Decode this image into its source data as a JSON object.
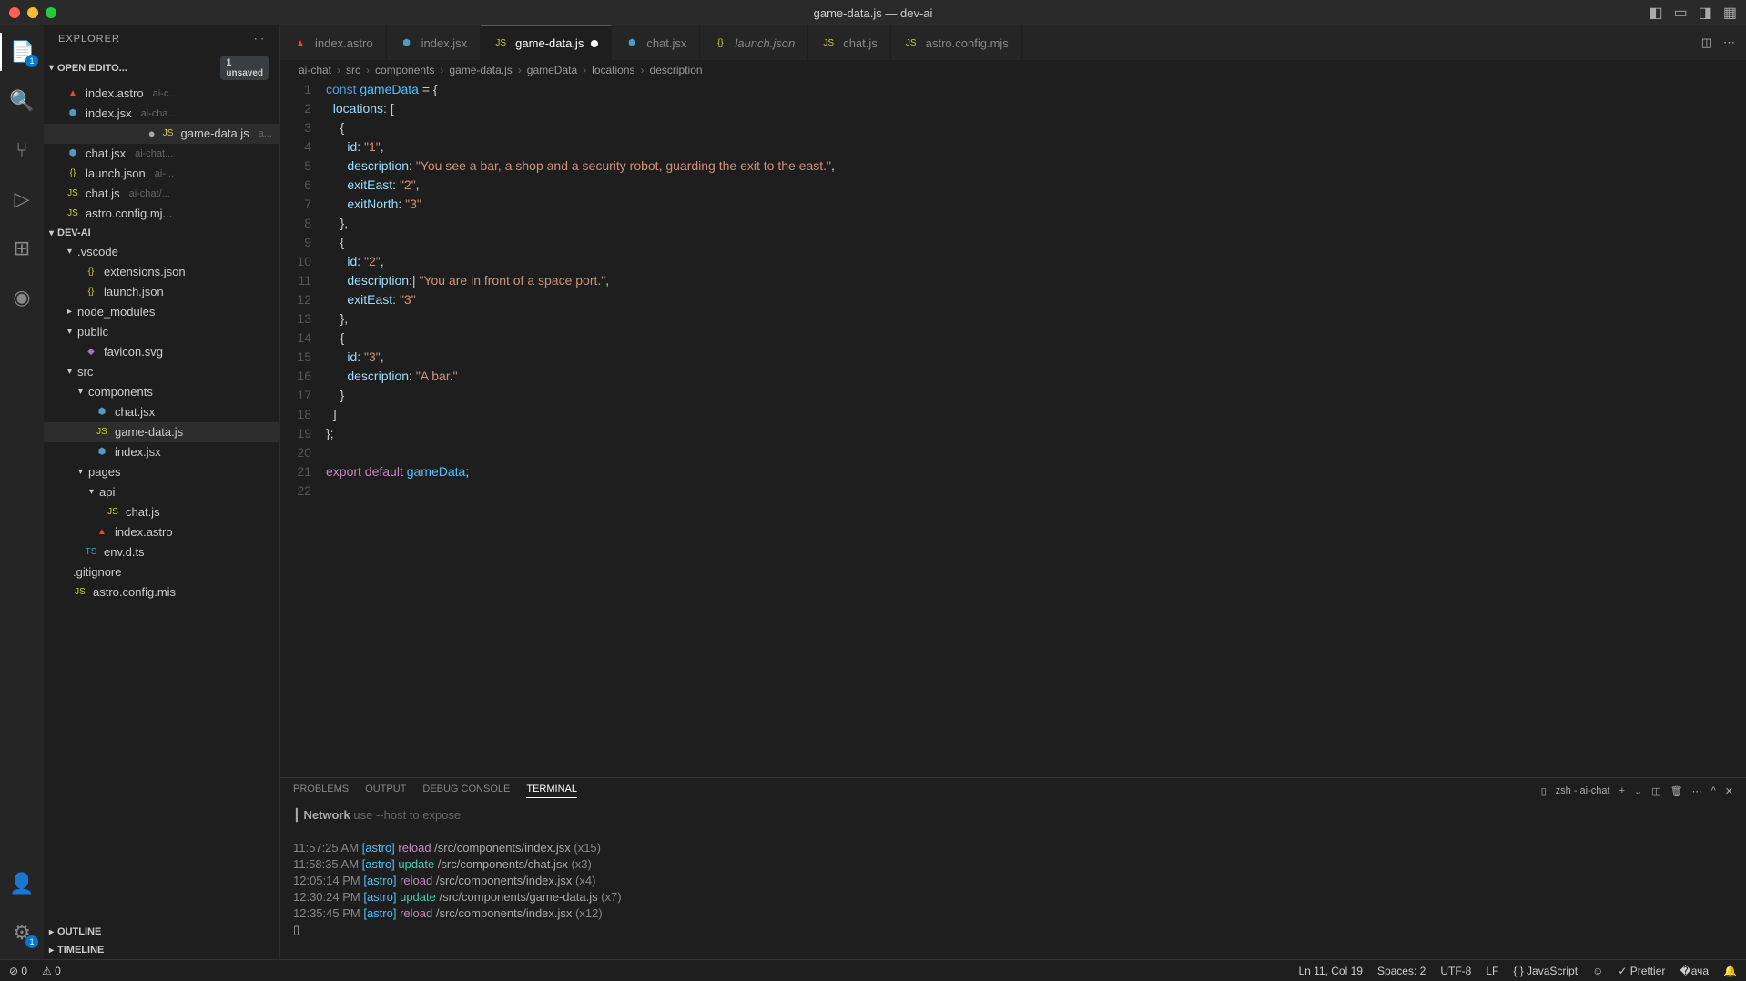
{
  "window": {
    "title": "game-data.js — dev-ai"
  },
  "sidebar": {
    "title": "EXPLORER",
    "openEditors": {
      "label": "OPEN EDITO...",
      "badge": {
        "count": "1",
        "text": "unsaved"
      },
      "items": [
        {
          "icon": "astro",
          "name": "index.astro",
          "hint": "ai-c..."
        },
        {
          "icon": "jsx",
          "name": "index.jsx",
          "hint": "ai-cha..."
        },
        {
          "icon": "js",
          "name": "game-data.js",
          "hint": "a...",
          "modified": true,
          "selected": true
        },
        {
          "icon": "jsx",
          "name": "chat.jsx",
          "hint": "ai-chat..."
        },
        {
          "icon": "json",
          "name": "launch.json",
          "hint": "ai-..."
        },
        {
          "icon": "js",
          "name": "chat.js",
          "hint": "ai-chat/..."
        },
        {
          "icon": "js",
          "name": "astro.config.mj...",
          "hint": ""
        }
      ]
    },
    "project": {
      "label": "DEV-AI"
    },
    "tree": [
      {
        "indent": 1,
        "chev": "v",
        "name": ".vscode"
      },
      {
        "indent": 2,
        "icon": "json",
        "name": "extensions.json"
      },
      {
        "indent": 2,
        "icon": "json",
        "name": "launch.json"
      },
      {
        "indent": 1,
        "chev": ">",
        "name": "node_modules"
      },
      {
        "indent": 1,
        "chev": "v",
        "name": "public"
      },
      {
        "indent": 2,
        "icon": "svg",
        "name": "favicon.svg"
      },
      {
        "indent": 1,
        "chev": "v",
        "name": "src"
      },
      {
        "indent": 2,
        "chev": "v",
        "name": "components"
      },
      {
        "indent": 3,
        "icon": "jsx",
        "name": "chat.jsx"
      },
      {
        "indent": 3,
        "icon": "js",
        "name": "game-data.js",
        "selected": true
      },
      {
        "indent": 3,
        "icon": "jsx",
        "name": "index.jsx"
      },
      {
        "indent": 2,
        "chev": "v",
        "name": "pages"
      },
      {
        "indent": 3,
        "chev": "v",
        "name": "api"
      },
      {
        "indent": 4,
        "icon": "js",
        "name": "chat.js"
      },
      {
        "indent": 3,
        "icon": "astro",
        "name": "index.astro"
      },
      {
        "indent": 2,
        "icon": "ts",
        "name": "env.d.ts"
      },
      {
        "indent": 1,
        "icon": "",
        "name": ".gitignore"
      },
      {
        "indent": 1,
        "icon": "js",
        "name": "astro.config.mis"
      }
    ],
    "outline": "OUTLINE",
    "timeline": "TIMELINE"
  },
  "tabs": [
    {
      "icon": "astro",
      "label": "index.astro"
    },
    {
      "icon": "jsx",
      "label": "index.jsx"
    },
    {
      "icon": "js",
      "label": "game-data.js",
      "active": true,
      "modified": true
    },
    {
      "icon": "jsx",
      "label": "chat.jsx"
    },
    {
      "icon": "json",
      "label": "launch.json",
      "italic": true
    },
    {
      "icon": "js",
      "label": "chat.js"
    },
    {
      "icon": "js",
      "label": "astro.config.mjs"
    }
  ],
  "breadcrumb": [
    "ai-chat",
    "src",
    "components",
    "game-data.js",
    "gameData",
    "locations",
    "description"
  ],
  "code": {
    "lines": 22,
    "content": [
      {
        "n": 1,
        "t": [
          {
            "c": "c",
            "s": "const "
          },
          {
            "c": "v",
            "s": "gameData"
          },
          {
            "c": "d",
            "s": " = {"
          }
        ]
      },
      {
        "n": 2,
        "t": [
          {
            "c": "d",
            "s": "  "
          },
          {
            "c": "p",
            "s": "locations"
          },
          {
            "c": "d",
            "s": ": ["
          }
        ]
      },
      {
        "n": 3,
        "t": [
          {
            "c": "d",
            "s": "    {"
          }
        ]
      },
      {
        "n": 4,
        "t": [
          {
            "c": "d",
            "s": "      "
          },
          {
            "c": "p",
            "s": "id"
          },
          {
            "c": "d",
            "s": ": "
          },
          {
            "c": "s",
            "s": "\"1\""
          },
          {
            "c": "d",
            "s": ","
          }
        ]
      },
      {
        "n": 5,
        "t": [
          {
            "c": "d",
            "s": "      "
          },
          {
            "c": "p",
            "s": "description"
          },
          {
            "c": "d",
            "s": ": "
          },
          {
            "c": "s",
            "s": "\"You see a bar, a shop and a security robot, guarding the exit to the east.\""
          },
          {
            "c": "d",
            "s": ","
          }
        ]
      },
      {
        "n": 6,
        "t": [
          {
            "c": "d",
            "s": "      "
          },
          {
            "c": "p",
            "s": "exitEast"
          },
          {
            "c": "d",
            "s": ": "
          },
          {
            "c": "s",
            "s": "\"2\""
          },
          {
            "c": "d",
            "s": ","
          }
        ]
      },
      {
        "n": 7,
        "t": [
          {
            "c": "d",
            "s": "      "
          },
          {
            "c": "p",
            "s": "exitNorth"
          },
          {
            "c": "d",
            "s": ": "
          },
          {
            "c": "s",
            "s": "\"3\""
          }
        ]
      },
      {
        "n": 8,
        "t": [
          {
            "c": "d",
            "s": "    },"
          }
        ]
      },
      {
        "n": 9,
        "t": [
          {
            "c": "d",
            "s": "    {"
          }
        ]
      },
      {
        "n": 10,
        "t": [
          {
            "c": "d",
            "s": "      "
          },
          {
            "c": "p",
            "s": "id"
          },
          {
            "c": "d",
            "s": ": "
          },
          {
            "c": "s",
            "s": "\"2\""
          },
          {
            "c": "d",
            "s": ","
          }
        ]
      },
      {
        "n": 11,
        "t": [
          {
            "c": "d",
            "s": "      "
          },
          {
            "c": "p",
            "s": "description"
          },
          {
            "c": "d",
            "s": ":| "
          },
          {
            "c": "s",
            "s": "\"You are in front of a space port.\""
          },
          {
            "c": "d",
            "s": ","
          }
        ]
      },
      {
        "n": 12,
        "t": [
          {
            "c": "d",
            "s": "      "
          },
          {
            "c": "p",
            "s": "exitEast"
          },
          {
            "c": "d",
            "s": ": "
          },
          {
            "c": "s",
            "s": "\"3\""
          }
        ]
      },
      {
        "n": 13,
        "t": [
          {
            "c": "d",
            "s": "    },"
          }
        ]
      },
      {
        "n": 14,
        "t": [
          {
            "c": "d",
            "s": "    {"
          }
        ]
      },
      {
        "n": 15,
        "t": [
          {
            "c": "d",
            "s": "      "
          },
          {
            "c": "p",
            "s": "id"
          },
          {
            "c": "d",
            "s": ": "
          },
          {
            "c": "s",
            "s": "\"3\""
          },
          {
            "c": "d",
            "s": ","
          }
        ]
      },
      {
        "n": 16,
        "t": [
          {
            "c": "d",
            "s": "      "
          },
          {
            "c": "p",
            "s": "description"
          },
          {
            "c": "d",
            "s": ": "
          },
          {
            "c": "s",
            "s": "\"A bar.\""
          }
        ]
      },
      {
        "n": 17,
        "t": [
          {
            "c": "d",
            "s": "    }"
          }
        ]
      },
      {
        "n": 18,
        "t": [
          {
            "c": "d",
            "s": "  ]"
          }
        ]
      },
      {
        "n": 19,
        "t": [
          {
            "c": "d",
            "s": "};"
          }
        ]
      },
      {
        "n": 20,
        "t": []
      },
      {
        "n": 21,
        "t": [
          {
            "c": "k",
            "s": "export default "
          },
          {
            "c": "v",
            "s": "gameData"
          },
          {
            "c": "d",
            "s": ";"
          }
        ]
      },
      {
        "n": 22,
        "t": []
      }
    ]
  },
  "panel": {
    "tabs": [
      "PROBLEMS",
      "OUTPUT",
      "DEBUG CONSOLE",
      "TERMINAL"
    ],
    "activeTab": "TERMINAL",
    "shellLabel": "zsh - ai-chat",
    "network": {
      "label": "Network",
      "hint": "use --host to expose"
    },
    "lines": [
      {
        "ts": "11:57:25 AM",
        "tag": "[astro]",
        "act": "reload",
        "path": "/src/components/index.jsx",
        "count": "(x15)"
      },
      {
        "ts": "11:58:35 AM",
        "tag": "[astro]",
        "act": "update",
        "path": "/src/components/chat.jsx",
        "count": "(x3)"
      },
      {
        "ts": "12:05:14 PM",
        "tag": "[astro]",
        "act": "reload",
        "path": "/src/components/index.jsx",
        "count": "(x4)"
      },
      {
        "ts": "12:30:24 PM",
        "tag": "[astro]",
        "act": "update",
        "path": "/src/components/game-data.js",
        "count": "(x7)"
      },
      {
        "ts": "12:35:45 PM",
        "tag": "[astro]",
        "act": "reload",
        "path": "/src/components/index.jsx",
        "count": "(x12)"
      }
    ],
    "prompt": "▯"
  },
  "status": {
    "errors": "0",
    "warnings": "0",
    "pos": "Ln 11, Col 19",
    "spaces": "Spaces: 2",
    "enc": "UTF-8",
    "eol": "LF",
    "lang": "JavaScript",
    "prettier": "Prettier"
  }
}
